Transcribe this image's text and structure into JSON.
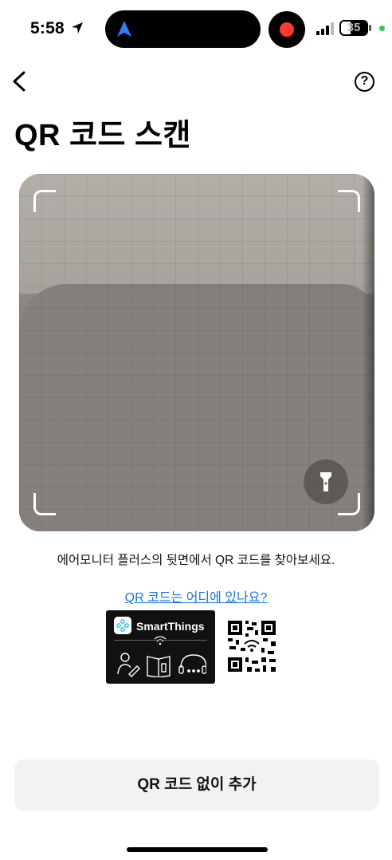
{
  "status_bar": {
    "time": "5:58",
    "battery": "35"
  },
  "header": {
    "title": "QR 코드 스캔",
    "help_glyph": "?"
  },
  "camera": {
    "flashlight_icon": "flashlight-icon"
  },
  "instruction": "에어모니터 플러스의 뒷면에서 QR 코드를 찾아보세요.",
  "help_link": "QR 코드는 어디에 있나요?",
  "label_illustration": {
    "brand": "SmartThings"
  },
  "bottom": {
    "add_without_qr": "QR 코드 없이 추가"
  },
  "colors": {
    "accent_link": "#1a73e8",
    "record": "#ff3b30",
    "button_bg": "#f2f2f4"
  }
}
